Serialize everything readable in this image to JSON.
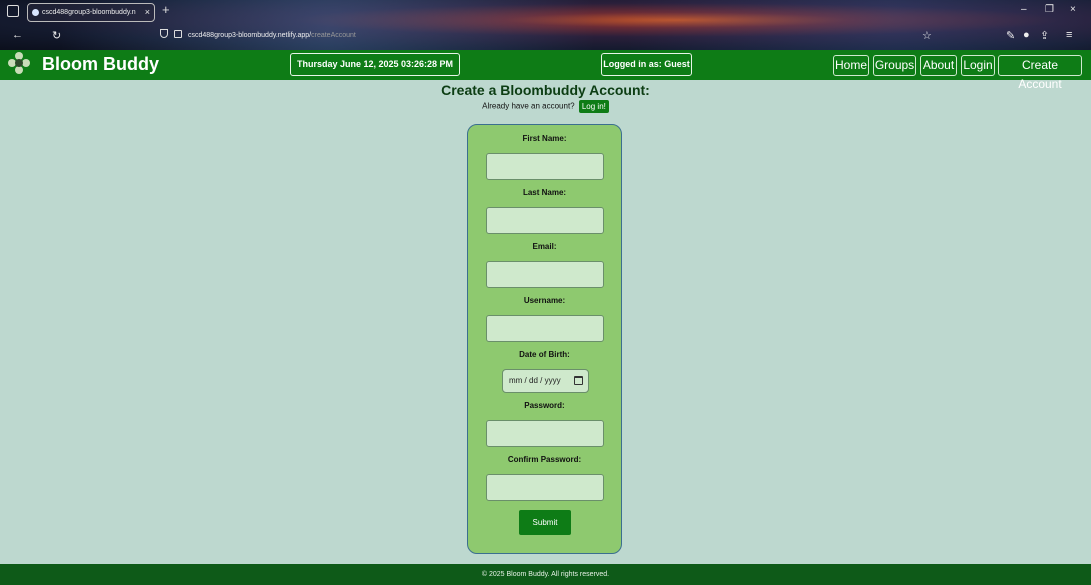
{
  "browser": {
    "tab_title": "cscd488group3-bloombuddy.n",
    "tab_close": "×",
    "new_tab": "+",
    "url_main": "cscd488group3-bloombuddy.netlify.app/",
    "url_path": "createAccount",
    "icons": [
      "window-icon",
      "back-icon",
      "reload-icon",
      "shield-icon",
      "lock-icon",
      "bookmark-star-icon",
      "extension-icon",
      "profile-icon",
      "share-icon",
      "menu-icon"
    ],
    "controls": {
      "minimize": "–",
      "maximize": "❐",
      "close": "×"
    }
  },
  "header": {
    "brand": "Bloom Buddy",
    "datetime": "Thursday June 12, 2025  03:26:28 PM",
    "logged_in": "Logged in as: Guest",
    "nav": [
      "Home",
      "Groups",
      "About",
      "Login",
      "Create Account"
    ],
    "color": "#0e7c16"
  },
  "main": {
    "title": "Create a Bloombuddy Account:",
    "subtitle": "Already have an account?",
    "login_link": "Log in!"
  },
  "form": {
    "first_name_label": "First Name:",
    "last_name_label": "Last Name:",
    "email_label": "Email:",
    "username_label": "Username:",
    "dob_label": "Date of Birth:",
    "dob_placeholder": "mm / dd / yyyy",
    "password_label": "Password:",
    "confirm_password_label": "Confirm Password:",
    "submit": "Submit"
  },
  "footer": {
    "text": "© 2025 Bloom Buddy. All rights reserved."
  }
}
